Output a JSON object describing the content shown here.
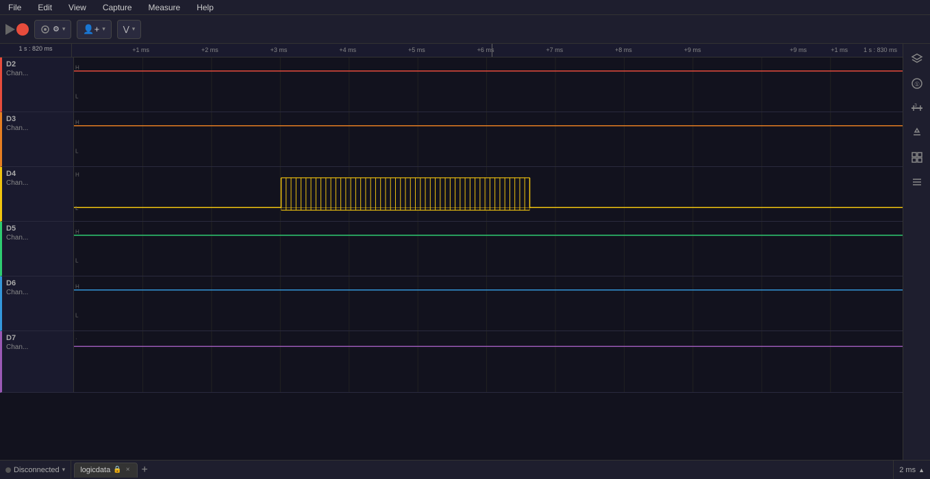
{
  "menu": {
    "items": [
      "File",
      "Edit",
      "View",
      "Capture",
      "Measure",
      "Help"
    ]
  },
  "toolbar": {
    "play_label": "",
    "device_label": "Device",
    "add_channel_label": "Add Channel",
    "trigger_label": "Trigger",
    "cursor_time": "1 s : 820 ms"
  },
  "time_ruler": {
    "left_ticks": [
      "+1 ms",
      "+2 ms",
      "+3 ms",
      "+4 ms",
      "+5 ms",
      "+6 ms",
      "+7 ms",
      "+8 ms",
      "+9 ms"
    ],
    "right_ticks": [
      "+1 ms",
      "+2 ms",
      "+3 ms",
      "+4 ms",
      "+5 ms",
      "+6 ms",
      "+7 ms",
      "+8 ms",
      "+9 ms"
    ],
    "top_right_time": "1 s : 830 ms",
    "right_end": "+1 ms"
  },
  "channels": [
    {
      "id": "D2",
      "name": "Chan...",
      "color": "#e74c3c",
      "signal": "high",
      "has_pulses": false
    },
    {
      "id": "D3",
      "name": "Chan...",
      "color": "#e67e22",
      "signal": "high",
      "has_pulses": false
    },
    {
      "id": "D4",
      "name": "Chan...",
      "color": "#f1c40f",
      "signal": "mixed",
      "has_pulses": true
    },
    {
      "id": "D5",
      "name": "Chan...",
      "color": "#2ecc71",
      "signal": "high",
      "has_pulses": false
    },
    {
      "id": "D6",
      "name": "Chan...",
      "color": "#3498db",
      "signal": "high",
      "has_pulses": false
    },
    {
      "id": "D7",
      "name": "Chan...",
      "color": "#9b59b6",
      "signal": "high",
      "has_pulses": false
    }
  ],
  "sidebar_icons": [
    "eye",
    "at",
    "ruler",
    "triangle-down",
    "grid",
    "list"
  ],
  "status_bar": {
    "disconnected_label": "Disconnected",
    "tab_label": "logicdata",
    "tab_close": "×",
    "add_tab": "+",
    "time_scale": "2 ms",
    "chevron": "▲"
  }
}
